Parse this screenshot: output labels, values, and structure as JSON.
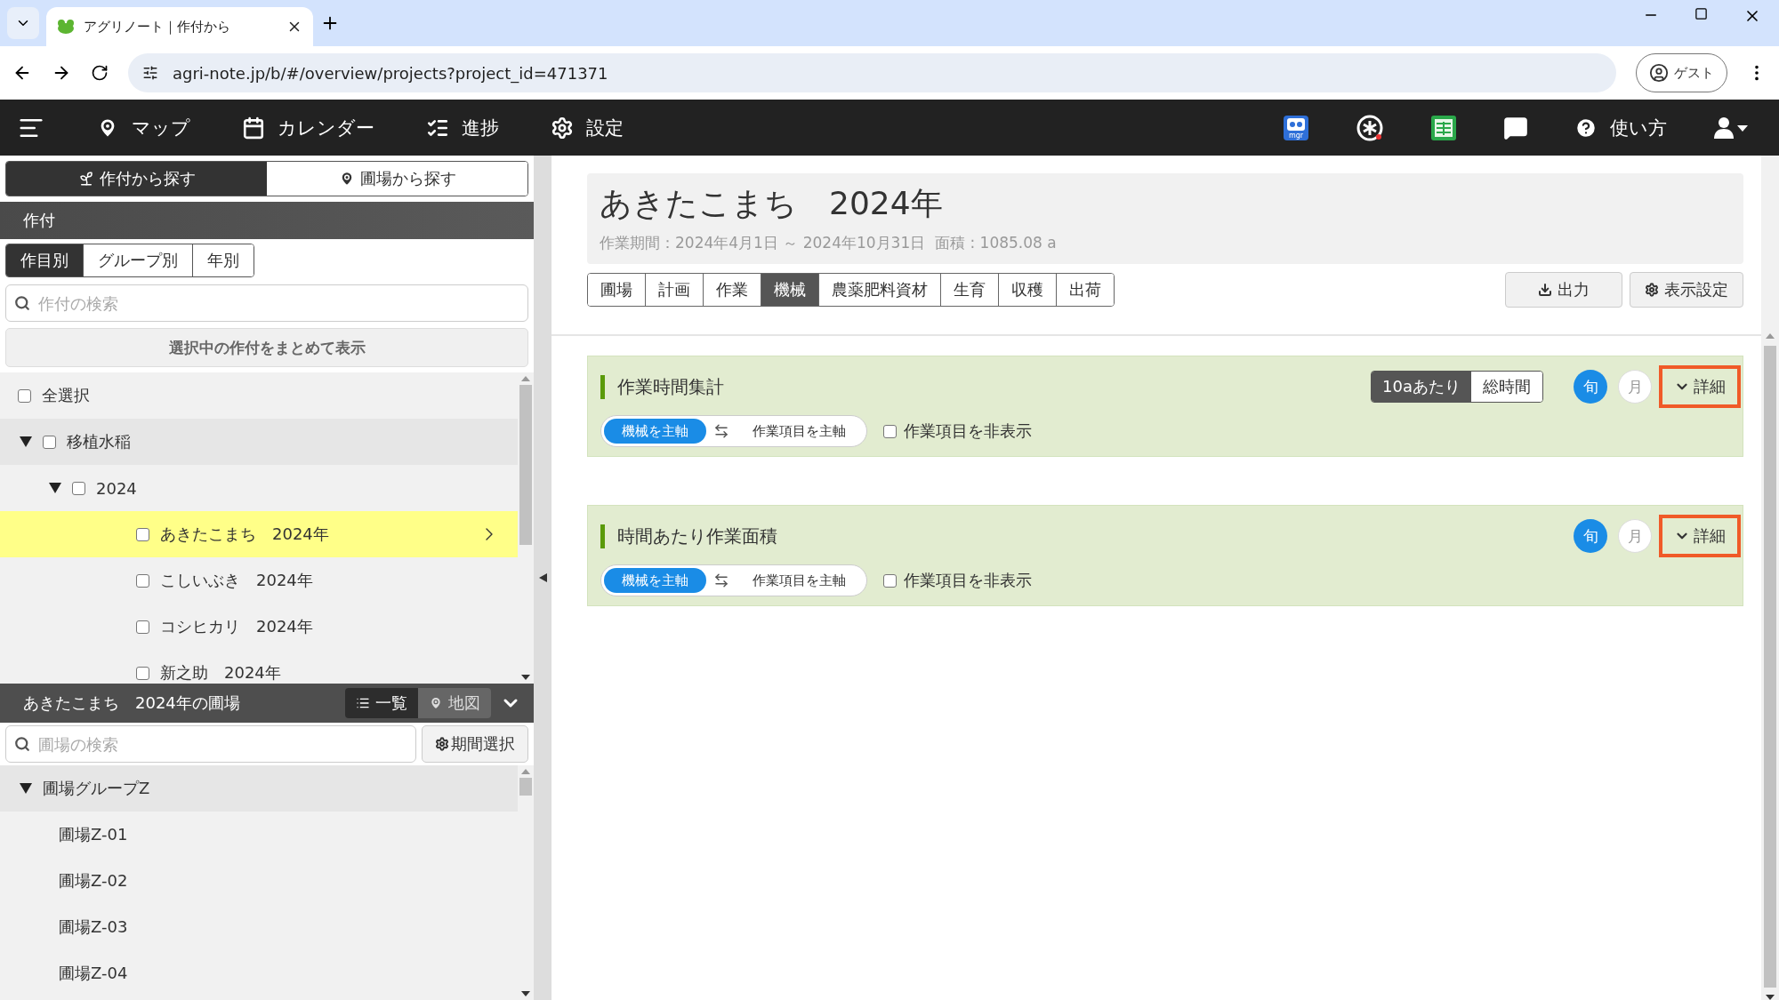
{
  "browser": {
    "tab_title": "アグリノート｜作付から",
    "url": "agri-note.jp/b/#/overview/projects?project_id=471371",
    "profile": "ゲスト"
  },
  "nav": {
    "items": [
      {
        "kind": "map",
        "label": "マップ"
      },
      {
        "kind": "calendar",
        "label": "カレンダー"
      },
      {
        "kind": "progress",
        "label": "進捗"
      },
      {
        "kind": "settings",
        "label": "設定"
      }
    ],
    "tools": [
      {
        "kind": "mgr",
        "label": "mgr"
      },
      {
        "kind": "asterisk"
      },
      {
        "kind": "sheet"
      },
      {
        "kind": "chat"
      },
      {
        "kind": "help",
        "label": "使い方"
      },
      {
        "kind": "user"
      }
    ]
  },
  "sidebar": {
    "search_tabs": [
      {
        "kind": "sprout",
        "label": "作付から探す",
        "selected": true
      },
      {
        "kind": "pin",
        "label": "圃場から探す",
        "selected": false
      }
    ],
    "section_title": "作付",
    "group_tabs": [
      {
        "label": "作目別",
        "selected": true
      },
      {
        "label": "グループ別",
        "selected": false
      },
      {
        "label": "年別",
        "selected": false
      }
    ],
    "search": {
      "placeholder": "作付の検索"
    },
    "combine_button": "選択中の作付をまとめて表示",
    "select_all": {
      "label": "全選択",
      "checked": false
    },
    "tree": [
      {
        "label": "移植水稲",
        "checked": false,
        "expanded": true,
        "children": [
          {
            "label": "2024",
            "checked": false,
            "expanded": true,
            "children": [
              {
                "label": "あきたこまち　2024年",
                "checked": false,
                "selected": true
              },
              {
                "label": "こしいぶき　2024年",
                "checked": false,
                "selected": false
              },
              {
                "label": "コシヒカリ　2024年",
                "checked": false,
                "selected": false
              },
              {
                "label": "新之助　2024年",
                "checked": false,
                "selected": false
              }
            ]
          }
        ]
      }
    ],
    "fields_panel": {
      "title": "あきたこまち　2024年の圃場",
      "views": [
        {
          "kind": "list",
          "label": "一覧",
          "selected": true
        },
        {
          "kind": "map",
          "label": "地図",
          "selected": false
        }
      ],
      "search": {
        "placeholder": "圃場の検索"
      },
      "period_button": "期間選択",
      "groups": [
        {
          "label": "圃場グループZ",
          "expanded": true,
          "children": [
            {
              "label": "圃場Z-01"
            },
            {
              "label": "圃場Z-02"
            },
            {
              "label": "圃場Z-03"
            },
            {
              "label": "圃場Z-04"
            }
          ]
        }
      ]
    }
  },
  "main": {
    "title": "あきたこまち　2024年",
    "subtitle": "作業期間：2024年4月1日 ～ 2024年10月31日  面積 : 1085.08 a",
    "tabs": [
      {
        "label": "圃場",
        "selected": false
      },
      {
        "label": "計画",
        "selected": false
      },
      {
        "label": "作業",
        "selected": false
      },
      {
        "label": "機械",
        "selected": true
      },
      {
        "label": "農薬肥料資材",
        "selected": false
      },
      {
        "label": "生育",
        "selected": false
      },
      {
        "label": "収穫",
        "selected": false
      },
      {
        "label": "出荷",
        "selected": false
      }
    ],
    "export_button": "出力",
    "display_settings_button": "表示設定",
    "cards": [
      {
        "title": "作業時間集計",
        "units": [
          {
            "label": "10aあたり",
            "selected": true
          },
          {
            "label": "総時間",
            "selected": false
          }
        ],
        "periods": [
          {
            "label": "旬",
            "selected": true
          },
          {
            "label": "月",
            "selected": false
          }
        ],
        "detail": {
          "label": "詳細",
          "highlighted": true
        },
        "axes": [
          {
            "label": "機械を主軸",
            "selected": true
          },
          {
            "label": "作業項目を主軸",
            "selected": false
          }
        ],
        "hide_items": {
          "label": "作業項目を非表示",
          "checked": false
        }
      },
      {
        "title": "時間あたり作業面積",
        "periods": [
          {
            "label": "旬",
            "selected": true
          },
          {
            "label": "月",
            "selected": false
          }
        ],
        "detail": {
          "label": "詳細",
          "highlighted": true
        },
        "axes": [
          {
            "label": "機械を主軸",
            "selected": true
          },
          {
            "label": "作業項目を主軸",
            "selected": false
          }
        ],
        "hide_items": {
          "label": "作業項目を非表示",
          "checked": false
        }
      }
    ]
  }
}
